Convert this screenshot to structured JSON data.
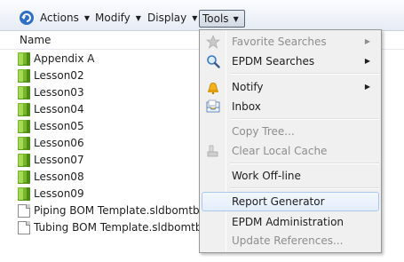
{
  "toolbar": {
    "refresh_icon": "refresh-icon",
    "menus": [
      {
        "label": "Actions"
      },
      {
        "label": "Modify"
      },
      {
        "label": "Display"
      }
    ],
    "tools_label": "Tools"
  },
  "list": {
    "column_name": "Name",
    "items": [
      {
        "label": "Appendix A",
        "icon": "folder-icon"
      },
      {
        "label": "Lesson02",
        "icon": "folder-icon"
      },
      {
        "label": "Lesson03",
        "icon": "folder-icon"
      },
      {
        "label": "Lesson04",
        "icon": "folder-icon"
      },
      {
        "label": "Lesson05",
        "icon": "folder-icon"
      },
      {
        "label": "Lesson06",
        "icon": "folder-icon"
      },
      {
        "label": "Lesson07",
        "icon": "folder-icon"
      },
      {
        "label": "Lesson08",
        "icon": "folder-icon"
      },
      {
        "label": "Lesson09",
        "icon": "folder-icon"
      },
      {
        "label": "Piping BOM Template.sldbomtbt",
        "icon": "document-icon"
      },
      {
        "label": "Tubing BOM Template.sldbomtbt",
        "icon": "document-icon"
      }
    ]
  },
  "tools_menu": {
    "items": [
      {
        "label": "Favorite Searches",
        "icon": "star-icon",
        "disabled": true,
        "submenu": true
      },
      {
        "label": "EPDM Searches",
        "icon": "magnifier-icon",
        "disabled": false,
        "submenu": true
      },
      {
        "label": "Notify",
        "icon": "bell-icon",
        "disabled": false,
        "submenu": true
      },
      {
        "label": "Inbox",
        "icon": "inbox-icon",
        "disabled": false,
        "submenu": false
      },
      {
        "label": "Copy Tree...",
        "icon": "",
        "disabled": true,
        "submenu": false
      },
      {
        "label": "Clear Local Cache",
        "icon": "cache-icon",
        "disabled": true,
        "submenu": false
      },
      {
        "label": "Work Off-line",
        "icon": "",
        "disabled": false,
        "submenu": false
      },
      {
        "label": "Report Generator",
        "icon": "",
        "disabled": false,
        "submenu": false,
        "highlighted": true
      },
      {
        "label": "EPDM Administration",
        "icon": "",
        "disabled": false,
        "submenu": false
      },
      {
        "label": "Update References...",
        "icon": "",
        "disabled": true,
        "submenu": false
      }
    ]
  },
  "colors": {
    "folder": "#78b72a",
    "hover_border": "#a8c8ef",
    "disabled_text": "#8d8d8d"
  }
}
